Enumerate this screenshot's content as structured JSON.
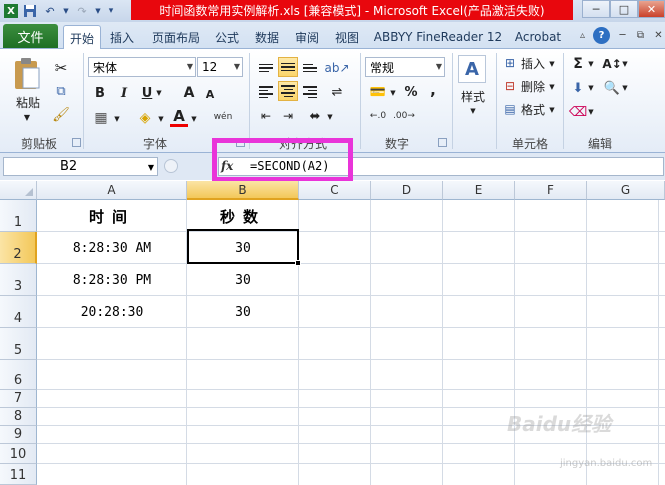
{
  "window": {
    "title": "时间函数常用实例解析.xls  [兼容模式] - Microsoft Excel(产品激活失败)",
    "minimize": "─",
    "maximize": "□",
    "close": "✕"
  },
  "tabs": {
    "file": "文件",
    "items": [
      "开始",
      "插入",
      "页面布局",
      "公式",
      "数据",
      "审阅",
      "视图",
      "ABBYY FineReader 12",
      "Acrobat"
    ]
  },
  "ribbon": {
    "clipboard": {
      "paste": "粘贴",
      "label": "剪贴板"
    },
    "font": {
      "name": "宋体",
      "size": "12",
      "bold": "B",
      "italic": "I",
      "underline": "U",
      "grow": "A",
      "shrink": "A",
      "label": "字体",
      "phonetic": "wén"
    },
    "alignment": {
      "label": "对齐方式"
    },
    "number": {
      "format": "常规",
      "percent": "%",
      "comma": ",",
      "label": "数字"
    },
    "styles": {
      "label": "样式"
    },
    "cells": {
      "insert": "插入",
      "delete": "删除",
      "format": "格式",
      "label": "单元格"
    },
    "editing": {
      "sum": "Σ",
      "label": "编辑"
    }
  },
  "formula_bar": {
    "name_box": "B2",
    "fx": "fx",
    "formula": "=SECOND(A2)"
  },
  "sheet": {
    "columns": [
      "A",
      "B",
      "C",
      "D",
      "E",
      "F",
      "G"
    ],
    "rows": [
      "1",
      "2",
      "3",
      "4",
      "5",
      "6",
      "7",
      "8",
      "9",
      "10",
      "11"
    ],
    "header_a": "时间",
    "header_b": "秒数",
    "a2": "8:28:30 AM",
    "a3": "8:28:30 PM",
    "a4": "20:28:30",
    "b2": "30",
    "b3": "30",
    "b4": "30",
    "selected_cell": "B2"
  },
  "watermark": {
    "text": "Baidu经验",
    "sub": "jingyan.baidu.com"
  }
}
